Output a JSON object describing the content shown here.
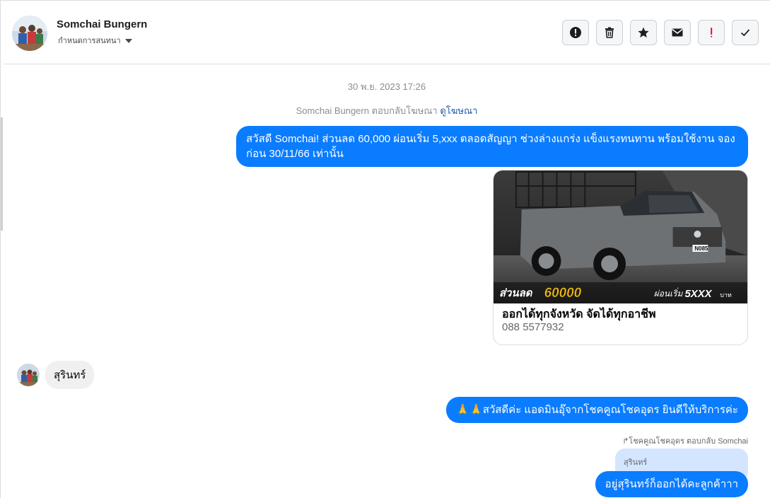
{
  "header": {
    "contact_name": "Somchai Bungern",
    "assign_label": "กำหนดการสนทนา",
    "actions": [
      {
        "icon": "alert-circle-icon",
        "label": "mark-spam"
      },
      {
        "icon": "trash-icon",
        "label": "delete"
      },
      {
        "icon": "star-icon",
        "label": "follow-up"
      },
      {
        "icon": "envelope-icon",
        "label": "mark-unread"
      },
      {
        "icon": "exclamation-icon",
        "label": "priority"
      },
      {
        "icon": "check-icon",
        "label": "done"
      }
    ]
  },
  "chat": {
    "timestamp": "30 พ.ย. 2023 17:26",
    "reply_note_prefix": "Somchai Bungern ตอบกลับโฆษณา",
    "reply_note_link": "ดูโฆษณา",
    "message1": "สวัสดี Somchai! ส่วนลด 60,000 ผ่อนเริ่ม 5,xxx ตลอดสัญญา ช่วงล่างแกร่ง แข็งแรงทนทาน พร้อมใช้งาน จองก่อน 30/11/66 เท่านั้น",
    "ad_card": {
      "overlay_discount_label": "ส่วนลด",
      "overlay_discount_value": "60000",
      "overlay_installment_label": "ผ่อนเริ่ม",
      "overlay_installment_value": "5XXX",
      "overlay_installment_unit": "บาท",
      "plate": "N085",
      "title": "ออกได้ทุกจังหวัด จัดได้ทุกอาชีพ",
      "subtitle": "088 5577932"
    },
    "incoming1": "สุรินทร์",
    "message2": "🙏🙏สวัสดีค่ะ แอดมินอุ๊จากโชคคูณโชคอุดร ยินดีให้บริการค่ะ",
    "reply_label": "โชคคูณโชคอุดร ตอบกลับ Somchai",
    "quoted_text": "สุรินทร์",
    "message3": "อยู่สุรินทร์ก็ออกได้คะลูกค้าาา"
  },
  "colors": {
    "outgoing_bubble": "#0a7cff",
    "incoming_bubble": "#f0f0f0",
    "quoted_bubble": "#d4e6ff",
    "priority_red": "#e41e3f"
  }
}
